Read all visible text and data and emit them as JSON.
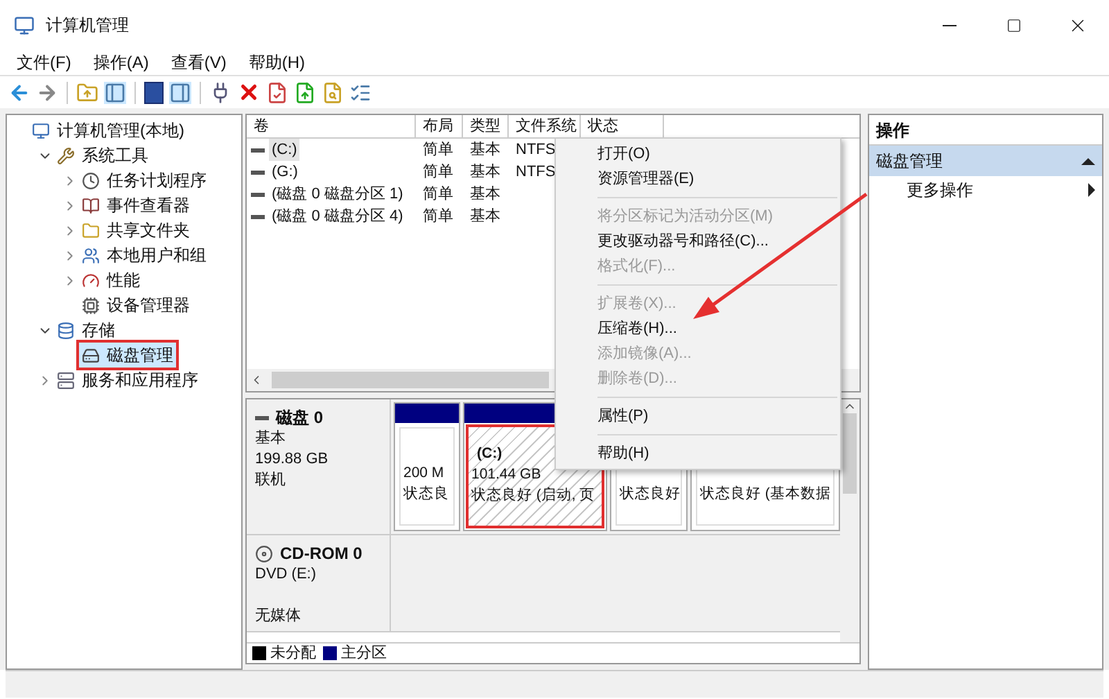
{
  "window": {
    "title": "计算机管理"
  },
  "menu": [
    "文件(F)",
    "操作(A)",
    "查看(V)",
    "帮助(H)"
  ],
  "tree": [
    {
      "label": "计算机管理(本地)",
      "kind": "computer",
      "selected": false,
      "children": [
        {
          "label": "系统工具",
          "kind": "tools",
          "expanded": true,
          "selected": false,
          "children": [
            {
              "label": "任务计划程序",
              "kind": "clock",
              "expanded": false,
              "selected": false
            },
            {
              "label": "事件查看器",
              "kind": "event",
              "expanded": false,
              "selected": false
            },
            {
              "label": "共享文件夹",
              "kind": "folder",
              "expanded": false,
              "selected": false
            },
            {
              "label": "本地用户和组",
              "kind": "users",
              "expanded": false,
              "selected": false
            },
            {
              "label": "性能",
              "kind": "perf",
              "expanded": false,
              "selected": false
            },
            {
              "label": "设备管理器",
              "kind": "device",
              "selected": false
            }
          ]
        },
        {
          "label": "存储",
          "kind": "storage",
          "expanded": true,
          "selected": false,
          "children": [
            {
              "label": "磁盘管理",
              "kind": "disk",
              "selected": true,
              "highlighted": true
            }
          ]
        },
        {
          "label": "服务和应用程序",
          "kind": "services",
          "expanded": false,
          "selected": false
        }
      ]
    }
  ],
  "table": {
    "columns": [
      "卷",
      "布局",
      "类型",
      "文件系统",
      "状态"
    ],
    "rows": [
      {
        "cells": [
          "(C:)",
          "简单",
          "基本",
          "NTFS"
        ],
        "selected": true
      },
      {
        "cells": [
          "(G:)",
          "简单",
          "基本",
          "NTFS"
        ],
        "selected": false
      },
      {
        "cells": [
          "(磁盘 0 磁盘分区 1)",
          "简单",
          "基本"
        ],
        "selected": false
      },
      {
        "cells": [
          "(磁盘 0 磁盘分区 4)",
          "简单",
          "基本"
        ],
        "selected": false
      }
    ]
  },
  "disks": [
    {
      "kind": "disk",
      "name": "磁盘 0",
      "lines": [
        "基本",
        "199.88 GB",
        "联机"
      ],
      "partitions": [
        {
          "lines": [
            "200 M",
            "状态良"
          ],
          "selected": false,
          "highlighted": false
        },
        {
          "lines": [
            "(C:)",
            "101.44 GB",
            "状态良好 (启动, 页"
          ],
          "selected": true,
          "highlighted": true
        },
        {
          "lines": [
            "状态良好"
          ],
          "selected": false,
          "highlighted": false
        },
        {
          "lines": [
            "状态良好 (基本数据"
          ],
          "selected": false,
          "highlighted": false
        }
      ]
    },
    {
      "kind": "cdrom",
      "name": "CD-ROM 0",
      "lines": [
        "DVD (E:)",
        "无媒体"
      ]
    }
  ],
  "legend": [
    {
      "label": "未分配",
      "color": "#000000"
    },
    {
      "label": "主分区",
      "color": "#000080"
    }
  ],
  "context_menu": [
    {
      "kind": "item",
      "label": "打开(O)",
      "disabled": false
    },
    {
      "kind": "item",
      "label": "资源管理器(E)",
      "disabled": false
    },
    {
      "kind": "separator"
    },
    {
      "kind": "item",
      "label": "将分区标记为活动分区(M)",
      "disabled": true
    },
    {
      "kind": "item",
      "label": "更改驱动器号和路径(C)...",
      "disabled": false
    },
    {
      "kind": "item",
      "label": "格式化(F)...",
      "disabled": true
    },
    {
      "kind": "separator"
    },
    {
      "kind": "item",
      "label": "扩展卷(X)...",
      "disabled": true
    },
    {
      "kind": "item",
      "label": "压缩卷(H)...",
      "disabled": false
    },
    {
      "kind": "item",
      "label": "添加镜像(A)...",
      "disabled": true
    },
    {
      "kind": "item",
      "label": "删除卷(D)...",
      "disabled": true
    },
    {
      "kind": "separator"
    },
    {
      "kind": "item",
      "label": "属性(P)",
      "disabled": false
    },
    {
      "kind": "separator"
    },
    {
      "kind": "item",
      "label": "帮助(H)",
      "disabled": false
    }
  ],
  "actions": {
    "title": "操作",
    "section": {
      "label": "磁盘管理",
      "expanded": true
    },
    "items": [
      "更多操作"
    ]
  }
}
